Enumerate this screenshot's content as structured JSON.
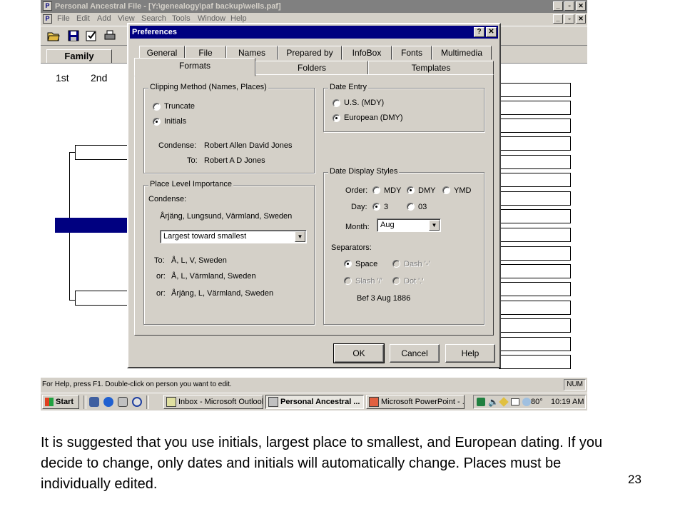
{
  "app": {
    "title": "Personal Ancestral File - [Y:\\genealogy\\paf backup\\wells.paf]",
    "menu": [
      "File",
      "Edit",
      "Add",
      "View",
      "Search",
      "Tools",
      "Window",
      "Help"
    ],
    "family_tab": "Family",
    "generations": [
      "1st",
      "2nd"
    ],
    "status_message": "For Help, press F1. Double-click on person you want to edit.",
    "status_num": "NUM"
  },
  "dialog": {
    "title": "Preferences",
    "help_btn": "?",
    "close_btn": "✕",
    "tabs_row1": [
      "General",
      "File",
      "Names",
      "Prepared by",
      "InfoBox",
      "Fonts",
      "Multimedia"
    ],
    "tabs_row2": [
      "Formats",
      "Folders",
      "Templates"
    ],
    "clipping": {
      "legend": "Clipping Method (Names, Places)",
      "truncate": "Truncate",
      "initials": "Initials",
      "condense_label": "Condense:",
      "condense_value": "Robert Allen David Jones",
      "to_label": "To:",
      "to_value": "Robert A D Jones"
    },
    "date_entry": {
      "legend": "Date Entry",
      "us": "U.S. (MDY)",
      "european": "European (DMY)"
    },
    "place": {
      "legend": "Place Level Importance",
      "condense_label": "Condense:",
      "condense_value": "Årjäng, Lungsund, Värmland, Sweden",
      "select_value": "Largest toward smallest",
      "to_label": "To:",
      "to_value": "Å, L, V, Sweden",
      "or_label": "or:",
      "or1_value": "Å, L, Värmland, Sweden",
      "or2_value": "Årjäng, L, Värmland, Sweden"
    },
    "date_display": {
      "legend": "Date Display Styles",
      "order_label": "Order:",
      "mdy": "MDY",
      "dmy": "DMY",
      "ymd": "YMD",
      "day_label": "Day:",
      "day_3": "3",
      "day_03": "03",
      "month_label": "Month:",
      "month_value": "Aug",
      "separators_label": "Separators:",
      "space": "Space",
      "dash": "Dash '-'",
      "slash": "Slash '/'",
      "dot": "Dot '.'",
      "example": "Bef 3 Aug 1886"
    },
    "buttons": {
      "ok": "OK",
      "cancel": "Cancel",
      "help": "Help"
    }
  },
  "taskbar": {
    "start": "Start",
    "items": [
      "Inbox - Microsoft Outlook",
      "Personal Ancestral ...",
      "Microsoft PowerPoint - ..."
    ],
    "tray_temp": "80°",
    "clock": "10:19 AM"
  },
  "slide": {
    "caption": "It is suggested that you use initials, largest place to smallest, and European dating.  If you decide to change, only dates and initials will automatically change.  Places must be individually edited.",
    "page_number": "23"
  },
  "colors": {
    "face": "#d4d0c8",
    "title_active": "#000080",
    "title_inactive": "#808080",
    "selected_person": "#000080"
  }
}
